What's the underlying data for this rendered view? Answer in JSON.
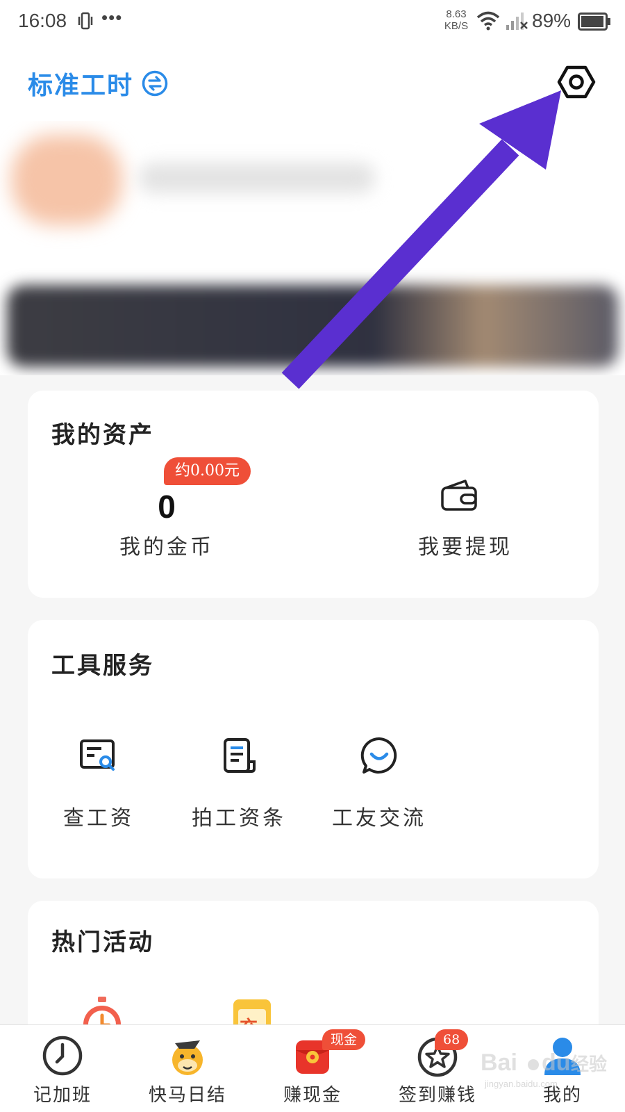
{
  "status_bar": {
    "time": "16:08",
    "more": "•••",
    "net_speed_value": "8.63",
    "net_speed_unit": "KB/S",
    "battery": "89%"
  },
  "header": {
    "mode_label": "标准工时",
    "icons": {
      "mode": "swap-icon",
      "settings": "settings-hexagon-icon"
    },
    "accent_color": "#2a8be8"
  },
  "assets_card": {
    "title": "我的资产",
    "coin_badge": "约0.00元",
    "coin_value": "0",
    "coin_label": "我的金币",
    "withdraw_label": "我要提现"
  },
  "tools_card": {
    "title": "工具服务",
    "items": [
      {
        "label": "查工资",
        "icon": "salary-search-icon"
      },
      {
        "label": "拍工资条",
        "icon": "payslip-icon"
      },
      {
        "label": "工友交流",
        "icon": "chat-bubble-icon"
      }
    ]
  },
  "activities_card": {
    "title": "热门活动",
    "icons": [
      "alarm-clock-icon",
      "recharge-icon"
    ],
    "recharge_char": "充"
  },
  "bottom_nav": {
    "items": [
      {
        "label": "记加班",
        "icon": "clock-icon"
      },
      {
        "label": "快马日结",
        "icon": "horse-mascot-icon"
      },
      {
        "label": "赚现金",
        "icon": "red-envelope-icon",
        "badge": "现金"
      },
      {
        "label": "签到赚钱",
        "icon": "star-checkin-icon",
        "badge": "68"
      },
      {
        "label": "我的",
        "icon": "user-icon",
        "active": true
      }
    ]
  },
  "watermark": {
    "text": "Bai du 经验",
    "sub": "jingyan.baidu.com"
  },
  "colors": {
    "badge": "#ef4f38",
    "annotation_arrow": "#5a2fd0",
    "active_tab": "#2a8be8"
  }
}
